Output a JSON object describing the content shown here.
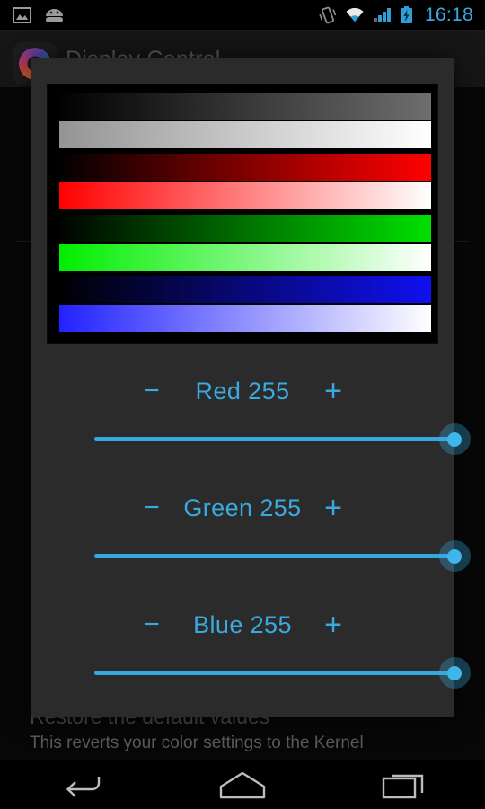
{
  "status_bar": {
    "time": "16:18",
    "icons": [
      "screenshot-icon",
      "android-head-icon",
      "vibrate-icon",
      "wifi-icon",
      "signal-icon",
      "battery-charging-icon"
    ],
    "accent_color": "#3aa9e0"
  },
  "app": {
    "title": "Display Control",
    "icon": "app-logo-icon"
  },
  "background_preference": {
    "title": "Restore the default values",
    "summary": "This reverts your color settings to the Kernel"
  },
  "dialog": {
    "preview": {
      "name": "color-gradient-preview",
      "bars": [
        {
          "name": "gray-dark",
          "from": "#000000",
          "to": "#6e6e6e"
        },
        {
          "name": "gray-light",
          "from": "#949494",
          "to": "#ffffff"
        },
        {
          "name": "red-dark",
          "from": "#000000",
          "to": "#ff0000"
        },
        {
          "name": "red-light",
          "from": "#ff0000",
          "to": "#ffffff"
        },
        {
          "name": "green-dark",
          "from": "#000000",
          "to": "#00e000"
        },
        {
          "name": "green-light",
          "from": "#00ee00",
          "to": "#ffffff"
        },
        {
          "name": "blue-dark",
          "from": "#000000",
          "to": "#1010f0"
        },
        {
          "name": "blue-light",
          "from": "#2222ff",
          "to": "#ffffff"
        }
      ]
    },
    "channels": [
      {
        "key": "red",
        "name": "Red",
        "value": 255,
        "label": "Red 255",
        "minus": "−",
        "plus": "+",
        "slider": {
          "min": 0,
          "max": 255,
          "value": 255,
          "percent": 100
        }
      },
      {
        "key": "green",
        "name": "Green",
        "value": 255,
        "label": "Green 255",
        "minus": "−",
        "plus": "+",
        "slider": {
          "min": 0,
          "max": 255,
          "value": 255,
          "percent": 100
        }
      },
      {
        "key": "blue",
        "name": "Blue",
        "value": 255,
        "label": "Blue 255",
        "minus": "−",
        "plus": "+",
        "slider": {
          "min": 0,
          "max": 255,
          "value": 255,
          "percent": 100
        }
      }
    ]
  },
  "nav_bar": {
    "buttons": [
      "back-icon",
      "home-icon",
      "recents-icon"
    ]
  }
}
